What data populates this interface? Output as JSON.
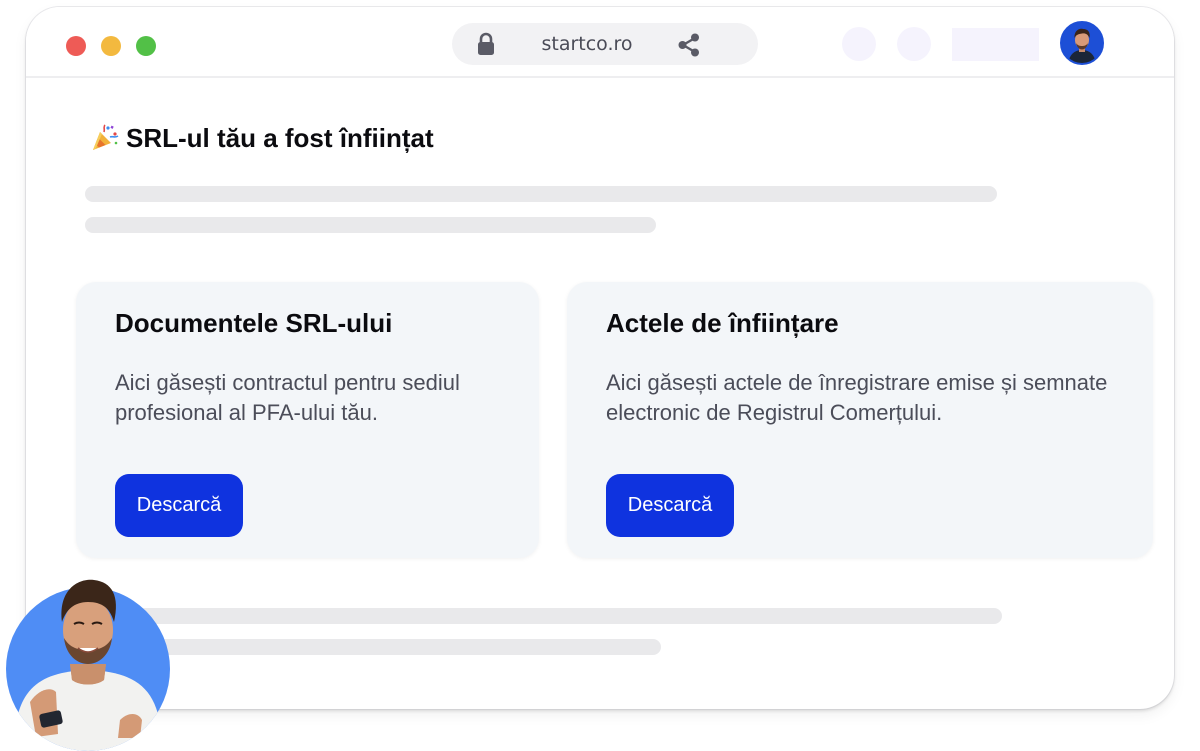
{
  "window": {
    "url": "startco.ro"
  },
  "page": {
    "heading": "SRL-ul tău a fost înființat",
    "cards": [
      {
        "title": "Documentele SRL-ului",
        "description": "Aici găsești contractul pentru sediul profesional al PFA-ului tău.",
        "button_label": "Descarcă"
      },
      {
        "title": "Actele de înființare",
        "description": "Aici găsești actele de înregistrare emise și semnate electronic de Registrul Comerțului.",
        "button_label": "Descarcă"
      }
    ]
  },
  "icons": {
    "lock": "lock-icon",
    "share": "share-icon",
    "party": "party-popper-icon"
  },
  "colors": {
    "accent": "#0f33df",
    "card_bg": "#f3f6f9",
    "avatar_bg": "#1d4fd6",
    "person_circle": "#4f8df5",
    "traffic_red": "#ee5b56",
    "traffic_yellow": "#f3b93f",
    "traffic_green": "#52c047"
  }
}
